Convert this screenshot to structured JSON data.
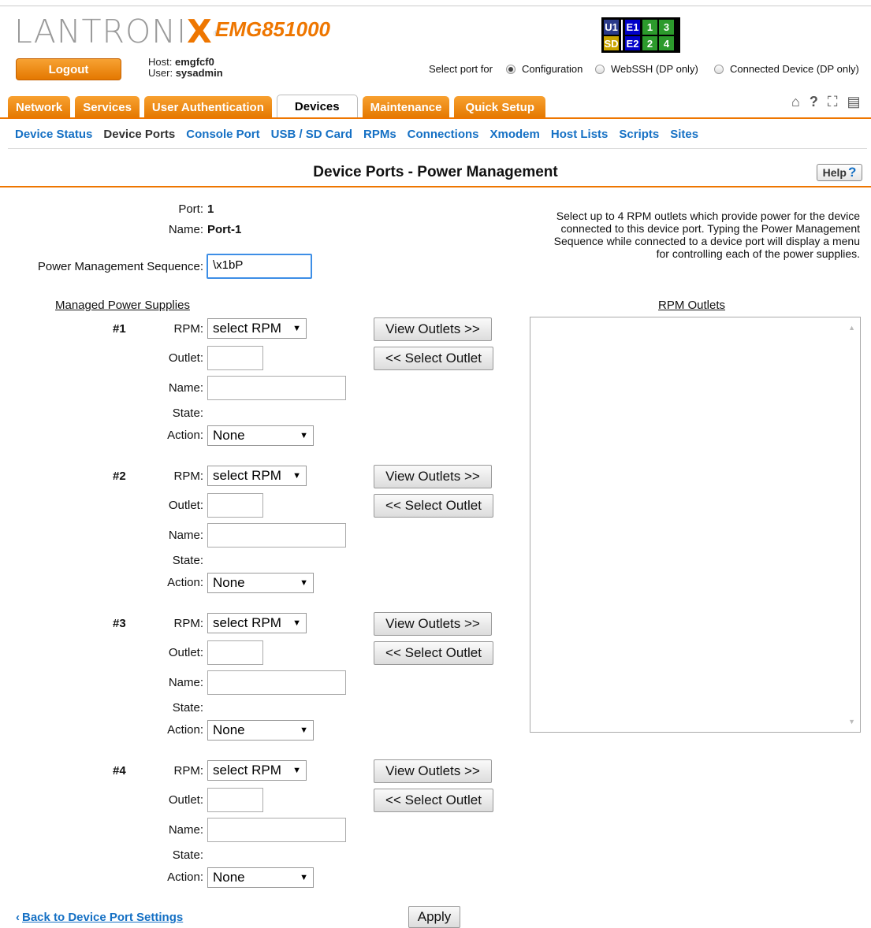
{
  "header": {
    "logo_text": "LANTRONIX",
    "model": "EMG851000",
    "logout_label": "Logout",
    "host_label": "Host:",
    "host_value": "emgfcf0",
    "user_label": "User:",
    "user_value": "sysadmin",
    "port_grid": [
      "U1",
      "E1",
      "1",
      "3",
      "SD",
      "E2",
      "2",
      "4"
    ],
    "select_port_label": "Select port for",
    "port_options": [
      {
        "label": "Configuration",
        "selected": true
      },
      {
        "label": "WebSSH (DP only)",
        "selected": false
      },
      {
        "label": "Connected Device (DP only)",
        "selected": false
      }
    ]
  },
  "tabs": [
    "Network",
    "Services",
    "User Authentication",
    "Devices",
    "Maintenance",
    "Quick Setup"
  ],
  "active_tab": "Devices",
  "subnav": [
    "Device Status",
    "Device Ports",
    "Console Port",
    "USB / SD Card",
    "RPMs",
    "Connections",
    "Xmodem",
    "Host Lists",
    "Scripts",
    "Sites"
  ],
  "active_subnav": "Device Ports",
  "page_title": "Device Ports - Power Management",
  "help_label": "Help",
  "port": {
    "port_label": "Port:",
    "port_value": "1",
    "name_label": "Name:",
    "name_value": "Port-1"
  },
  "pms_label": "Power Management Sequence:",
  "pms_value": "\\x1bP",
  "help_text": "Select up to 4 RPM outlets which provide power for the device connected to this device port. Typing the Power Management Sequence while connected to a device port will display a menu for controlling each of the power supplies.",
  "managed_label": "Managed Power Supplies",
  "rpm_outlets_label": "RPM Outlets",
  "field_labels": {
    "rpm": "RPM:",
    "outlet": "Outlet:",
    "name": "Name:",
    "state": "State:",
    "action": "Action:"
  },
  "supplies": [
    {
      "num": "#1",
      "rpm": "select RPM",
      "outlet": "",
      "name": "",
      "state": "",
      "action": "None"
    },
    {
      "num": "#2",
      "rpm": "select RPM",
      "outlet": "",
      "name": "",
      "state": "",
      "action": "None"
    },
    {
      "num": "#3",
      "rpm": "select RPM",
      "outlet": "",
      "name": "",
      "state": "",
      "action": "None"
    },
    {
      "num": "#4",
      "rpm": "select RPM",
      "outlet": "",
      "name": "",
      "state": "",
      "action": "None"
    }
  ],
  "view_outlets_label": "View Outlets >>",
  "select_outlet_label": "<< Select Outlet",
  "back_link": "Back to Device Port Settings",
  "apply_label": "Apply",
  "colors": {
    "orange": "#ee7600",
    "link_blue": "#1570c4"
  }
}
